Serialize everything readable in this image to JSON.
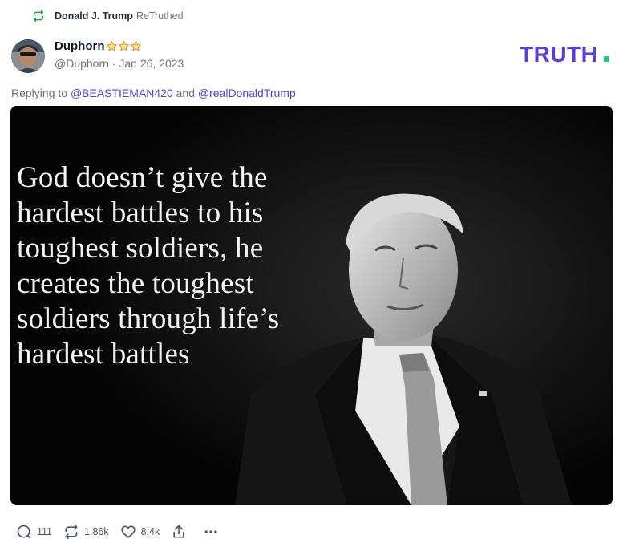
{
  "retruth": {
    "user": "Donald J. Trump",
    "label": "ReTruthed",
    "icon": "retruth-icon",
    "color": "#22a04b"
  },
  "post": {
    "author": {
      "name": "Duphorn",
      "handle": "@Duphorn",
      "date": "Jan 26, 2023",
      "badge": "three-star-badge"
    },
    "reply": {
      "prefix": "Replying to",
      "first": "@BEASTIEMAN420",
      "joiner": "and",
      "second": "@realDonaldTrump"
    },
    "image": {
      "quote_lines": [
        "God doesn’t give the",
        "hardest battles to his",
        "toughest soldiers, he",
        "creates the toughest",
        "soldiers through life’s",
        "hardest battles"
      ]
    },
    "stats": {
      "replies": "111",
      "retruths": "1.86k",
      "likes": "8.4k"
    }
  },
  "brand": {
    "logo_text": "TRUTH.",
    "logo_color": "#5b3fd1",
    "dot_color": "#22c58b"
  },
  "colors": {
    "link": "#5b3fd1",
    "meta": "#6b7280"
  }
}
